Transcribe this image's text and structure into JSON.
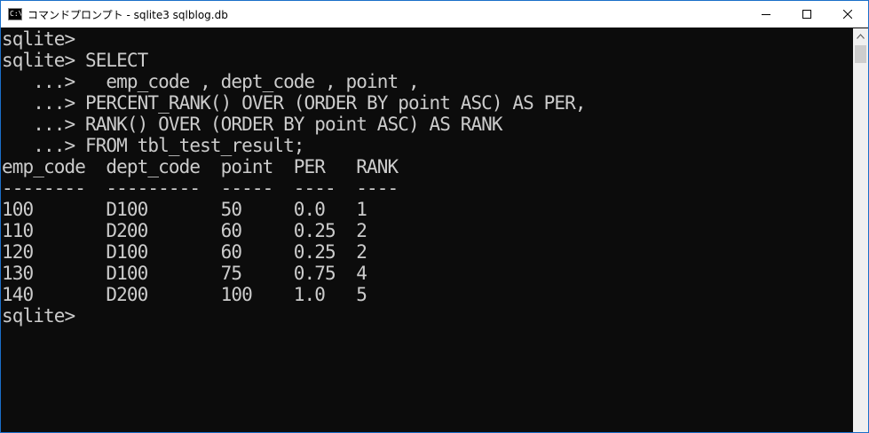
{
  "window": {
    "title": "コマンドプロンプト - sqlite3  sqlblog.db",
    "icon": "cmd-icon",
    "icon_text": "C:\\."
  },
  "controls": {
    "minimize": "minimize-icon",
    "maximize": "maximize-icon",
    "close": "close-icon"
  },
  "console": {
    "lines": [
      "sqlite>",
      "sqlite> SELECT",
      "   ...>   emp_code , dept_code , point ,",
      "   ...> PERCENT_RANK() OVER (ORDER BY point ASC) AS PER,",
      "   ...> RANK() OVER (ORDER BY point ASC) AS RANK",
      "   ...> FROM tbl_test_result;",
      "emp_code  dept_code  point  PER   RANK",
      "--------  ---------  -----  ----  ----",
      "100       D100       50     0.0   1",
      "110       D200       60     0.25  2",
      "120       D100       60     0.25  2",
      "130       D100       75     0.75  4",
      "140       D200       100    1.0   5",
      "sqlite>"
    ]
  },
  "colors": {
    "background": "#0c0c0c",
    "text": "#cccccc",
    "titlebar": "#ffffff",
    "border": "#1a6fc9"
  }
}
